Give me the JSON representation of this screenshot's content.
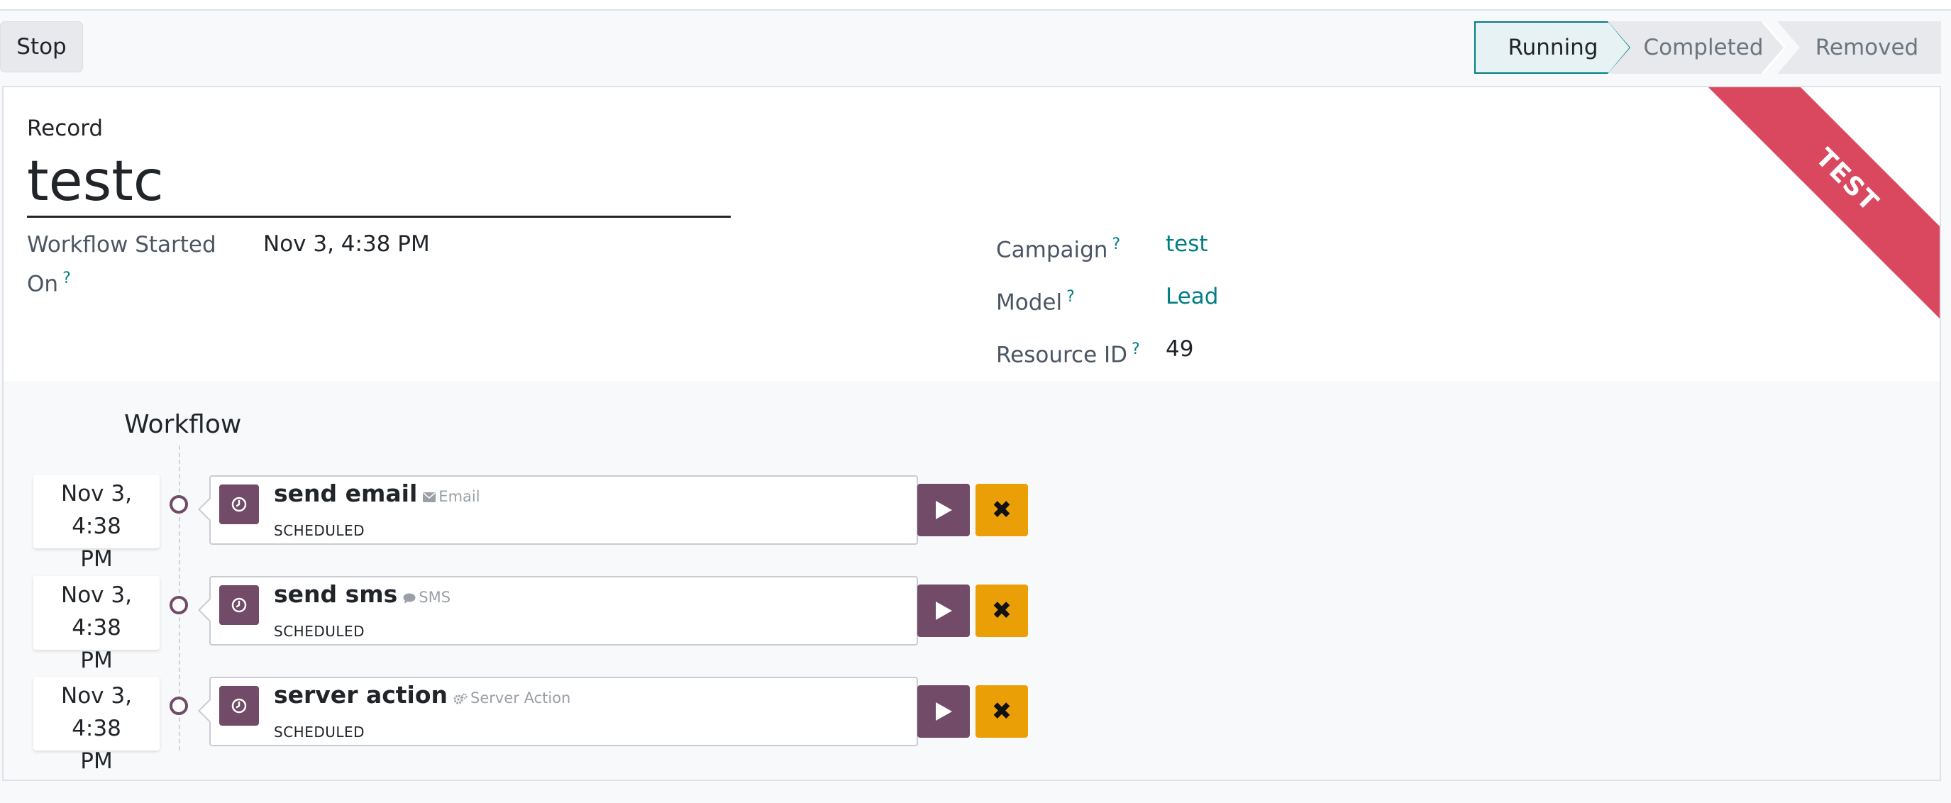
{
  "toolbar": {
    "stop_label": "Stop"
  },
  "statusbar": {
    "stages": [
      {
        "label": "Running",
        "active": true
      },
      {
        "label": "Completed",
        "active": false
      },
      {
        "label": "Removed",
        "active": false
      }
    ]
  },
  "sheet": {
    "record_label": "Record",
    "record_name": "testc",
    "ribbon": "TEST",
    "help_mark": "?",
    "started_label_line1": "Workflow Started",
    "started_label_line2": "On",
    "started_value": "Nov 3, 4:38 PM",
    "campaign_label": "Campaign",
    "campaign_value": "test",
    "model_label": "Model",
    "model_value": "Lead",
    "resource_label": "Resource ID",
    "resource_value": "49"
  },
  "workflow": {
    "title": "Workflow",
    "activities": [
      {
        "date_line1": "Nov 3, 4:38",
        "date_line2": "PM",
        "name": "send email",
        "type": "Email",
        "type_icon": "envelope-icon",
        "state": "SCHEDULED"
      },
      {
        "date_line1": "Nov 3, 4:38",
        "date_line2": "PM",
        "name": "send sms",
        "type": "SMS",
        "type_icon": "chat-bubble-icon",
        "state": "SCHEDULED"
      },
      {
        "date_line1": "Nov 3, 4:38",
        "date_line2": "PM",
        "name": "server action",
        "type": "Server Action",
        "type_icon": "cogs-icon",
        "state": "SCHEDULED"
      }
    ],
    "cancel_glyph": "✖"
  },
  "colors": {
    "primary": "#714b67",
    "accent_link": "#017e84",
    "warning": "#eb9f07",
    "ribbon": "#d9485f",
    "active_stage_bg": "#e6f2f3"
  }
}
